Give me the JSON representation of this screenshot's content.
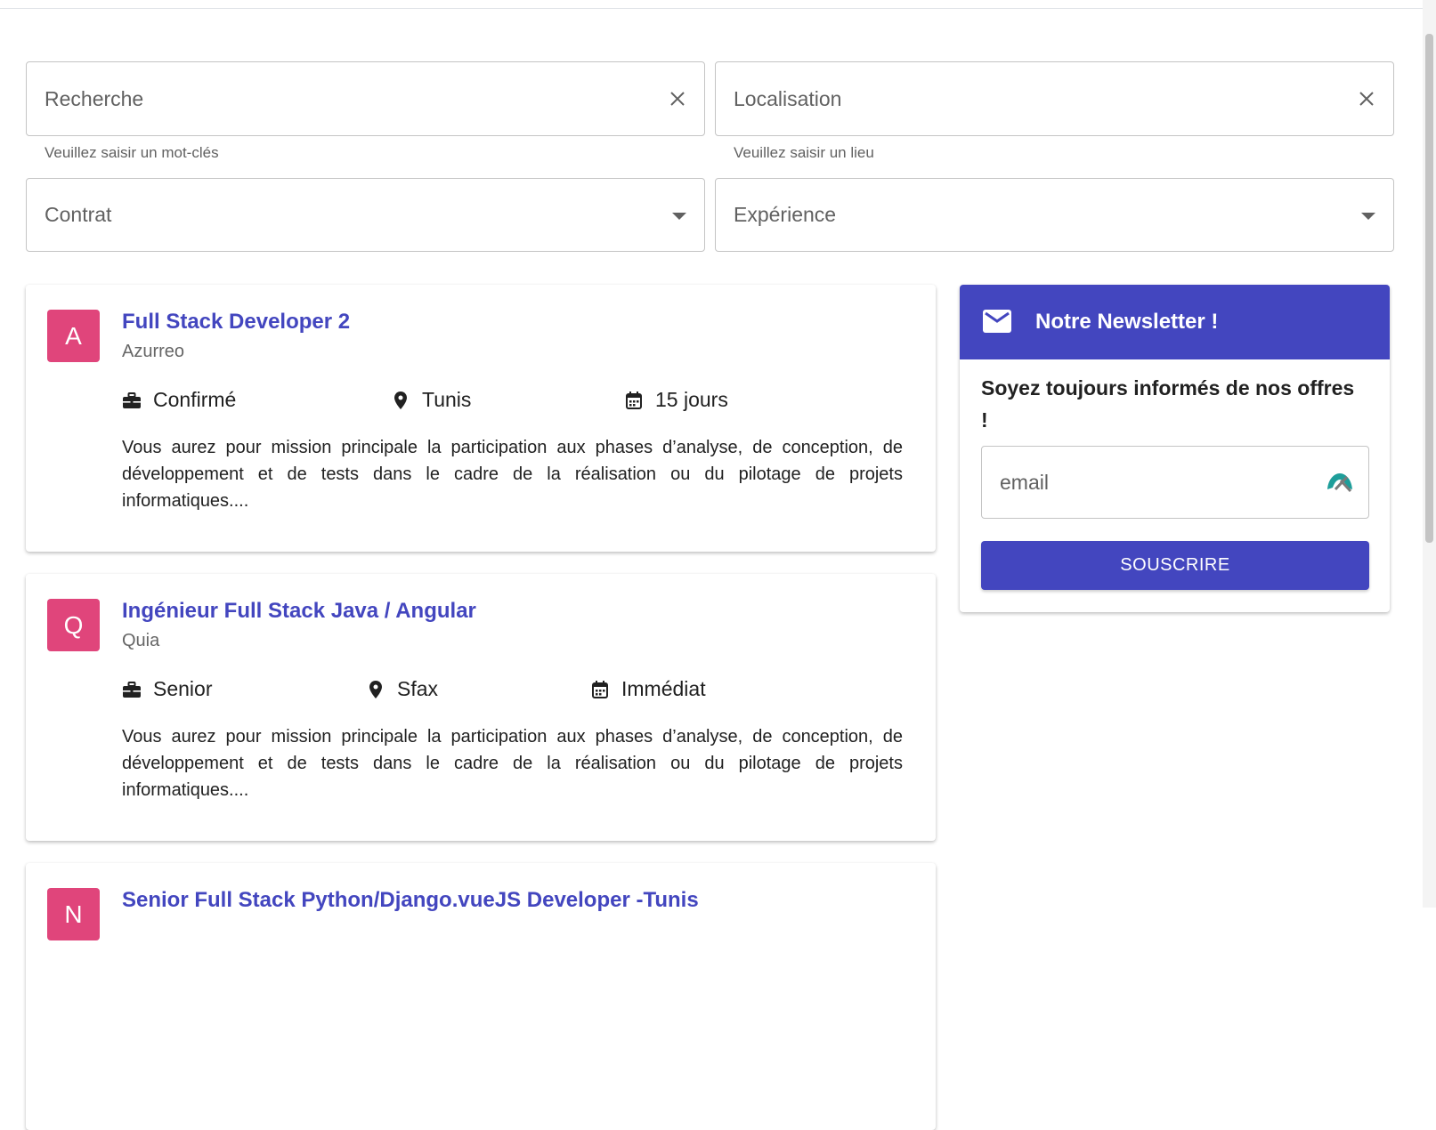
{
  "filters": {
    "search": {
      "placeholder": "Recherche",
      "helper": "Veuillez saisir un mot-clés",
      "clear_icon": "close-icon"
    },
    "location": {
      "placeholder": "Localisation",
      "helper": "Veuillez saisir un lieu",
      "clear_icon": "close-icon"
    },
    "contract": {
      "placeholder": "Contrat",
      "icon": "dropdown-arrow-icon"
    },
    "experience": {
      "placeholder": "Expérience",
      "icon": "dropdown-arrow-icon"
    }
  },
  "jobs": [
    {
      "initial": "A",
      "title": "Full Stack Developer 2",
      "company": "Azurreo",
      "level": "Confirmé",
      "location": "Tunis",
      "availability": "15 jours",
      "description": "Vous aurez pour mission principale la participation aux phases d’analyse, de conception, de développement et de tests dans le cadre de la réalisation ou du pilotage de projets informatiques...."
    },
    {
      "initial": "Q",
      "title": "Ingénieur Full Stack Java / Angular",
      "company": "Quia",
      "level": "Senior",
      "location": "Sfax",
      "availability": "Immédiat",
      "description": "Vous aurez pour mission principale la participation aux phases d’analyse, de conception, de développement et de tests dans le cadre de la réalisation ou du pilotage de projets informatiques...."
    },
    {
      "initial": "N",
      "title": "Senior Full Stack Python/Django.vueJS Developer -Tunis"
    }
  ],
  "newsletter": {
    "title": "Notre Newsletter !",
    "text": "Soyez toujours informés de nos offres !",
    "email_placeholder": "email",
    "button_label": "SOUSCRIRE"
  },
  "colors": {
    "primary": "#4346bf",
    "avatar": "#e0457b",
    "border": "#c4c4c4"
  }
}
